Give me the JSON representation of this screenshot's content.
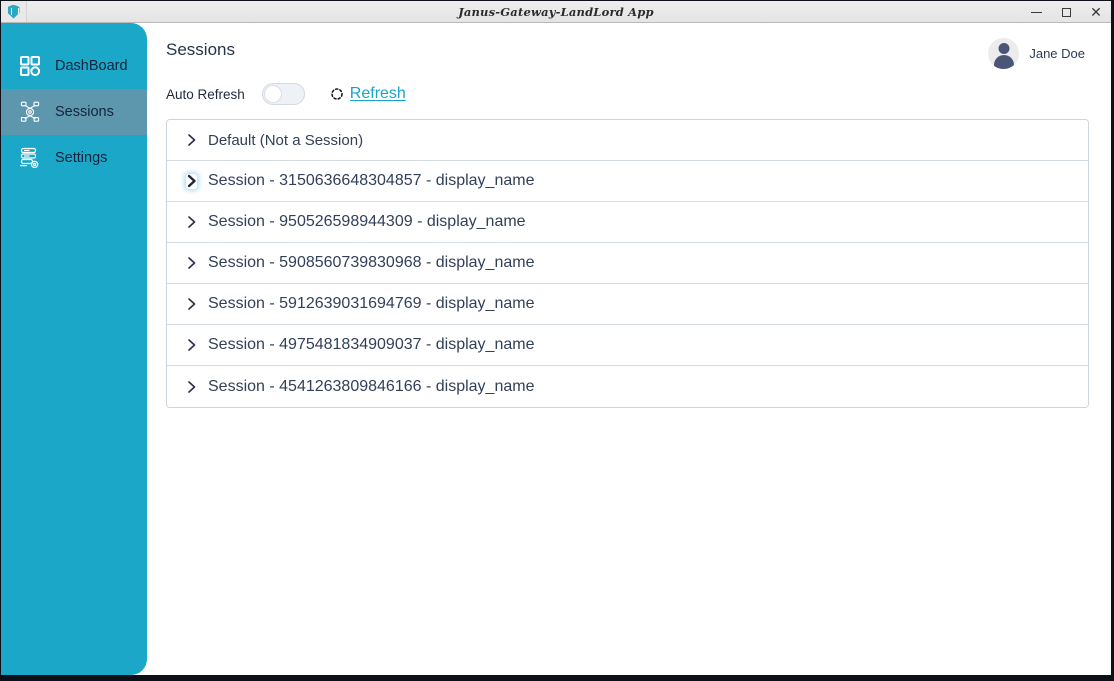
{
  "window": {
    "title": "Janus-Gateway-LandLord App",
    "logo_icon": "shield-icon",
    "controls": {
      "minimize": "minimize-icon",
      "maximize": "maximize-icon",
      "close": "close-icon"
    }
  },
  "colors": {
    "sidebar": "#1aa7c8",
    "sidebar_active": "#5c97ae",
    "link": "#18a5cb",
    "text_dark": "#32405a",
    "border": "#ccd4de"
  },
  "sidebar": {
    "items": [
      {
        "label": "DashBoard",
        "icon": "dashboard-grid-icon",
        "active": false
      },
      {
        "label": "Sessions",
        "icon": "network-sessions-icon",
        "active": true
      },
      {
        "label": "Settings",
        "icon": "server-gear-icon",
        "active": false
      }
    ]
  },
  "header": {
    "page_title": "Sessions",
    "user": {
      "name": "Jane Doe",
      "avatar_icon": "user-avatar-icon"
    }
  },
  "toolbar": {
    "auto_refresh_label": "Auto Refresh",
    "auto_refresh_on": false,
    "refresh_label": "Refresh",
    "refresh_icon": "refresh-spinner-icon"
  },
  "sessions": {
    "rows": [
      {
        "label": "Default (Not a Session)",
        "expanded": false,
        "focused": false,
        "small": true
      },
      {
        "label": "Session - 3150636648304857 - display_name",
        "expanded": false,
        "focused": true,
        "small": false
      },
      {
        "label": "Session - 950526598944309 - display_name",
        "expanded": false,
        "focused": false,
        "small": false
      },
      {
        "label": "Session - 5908560739830968 - display_name",
        "expanded": false,
        "focused": false,
        "small": false
      },
      {
        "label": "Session - 5912639031694769 - display_name",
        "expanded": false,
        "focused": false,
        "small": false
      },
      {
        "label": "Session - 4975481834909037 - display_name",
        "expanded": false,
        "focused": false,
        "small": false
      },
      {
        "label": "Session - 4541263809846166 - display_name",
        "expanded": false,
        "focused": false,
        "small": false
      }
    ]
  }
}
